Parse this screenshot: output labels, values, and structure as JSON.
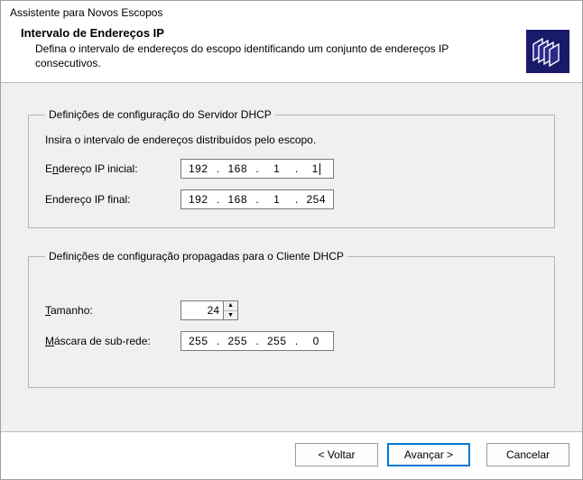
{
  "window_title": "Assistente para Novos Escopos",
  "header": {
    "title": "Intervalo de Endereços IP",
    "subtitle": "Defina o intervalo de endereços do escopo identificando um conjunto de endereços IP consecutivos."
  },
  "group_server": {
    "legend": "Definições de configuração do Servidor DHCP",
    "intro": "Insira o intervalo de endereços distribuídos pelo escopo.",
    "start_label_pre": "E",
    "start_label_u": "n",
    "start_label_post": "dereço IP inicial:",
    "end_label": "Endereço IP final:",
    "start_ip": [
      "192",
      "168",
      "1",
      "1"
    ],
    "end_ip": [
      "192",
      "168",
      "1",
      "254"
    ]
  },
  "group_client": {
    "legend": "Definições de configuração propagadas para o Cliente DHCP",
    "length_label_u": "T",
    "length_label_post": "amanho:",
    "length_value": "24",
    "mask_label_u": "M",
    "mask_label_post": "áscara de sub-rede:",
    "mask": [
      "255",
      "255",
      "255",
      "0"
    ]
  },
  "buttons": {
    "back": "< Voltar",
    "next": "Avançar >",
    "cancel": "Cancelar"
  }
}
